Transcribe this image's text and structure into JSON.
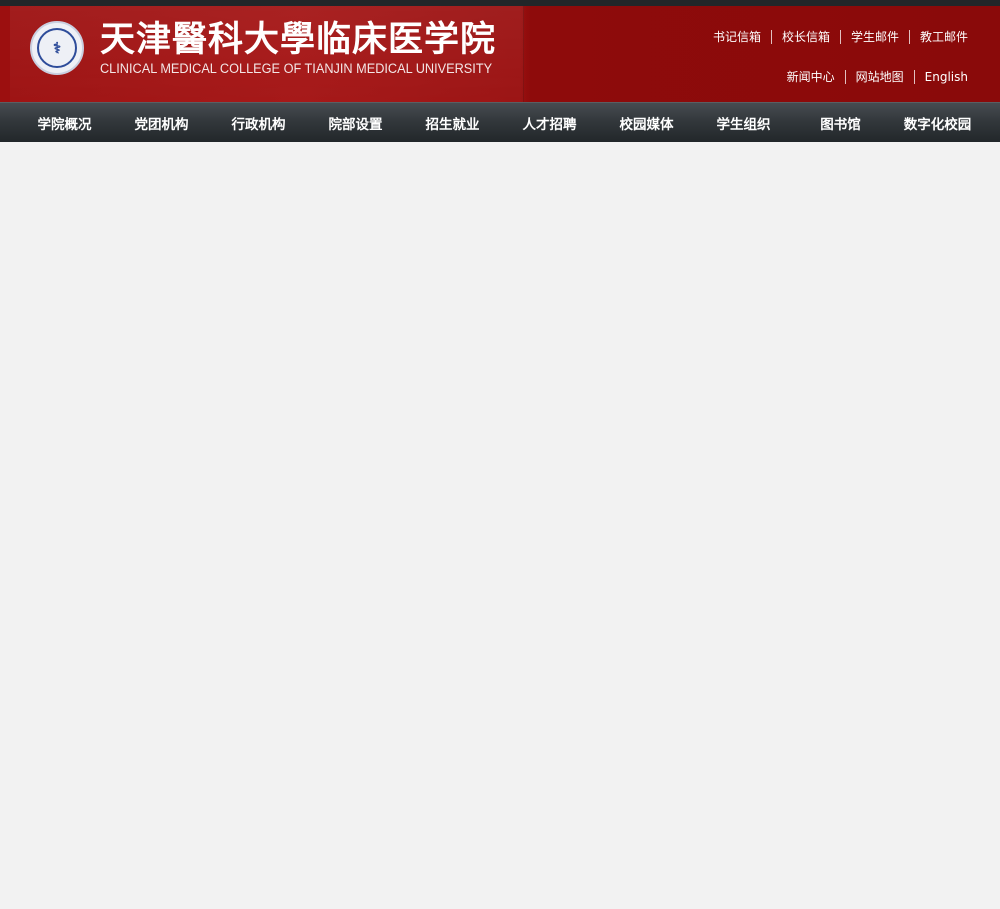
{
  "header": {
    "brand_cn": "天津醫科大學临床医学院",
    "brand_en": "CLINICAL MEDICAL COLLEGE OF TIANJIN MEDICAL UNIVERSITY",
    "seal_mark": "⚕"
  },
  "top_links_row1": [
    {
      "label": "书记信箱"
    },
    {
      "label": "校长信箱"
    },
    {
      "label": "学生邮件"
    },
    {
      "label": "教工邮件"
    }
  ],
  "top_links_row2": [
    {
      "label": "新闻中心"
    },
    {
      "label": "网站地图"
    },
    {
      "label": "English"
    }
  ],
  "nav": {
    "items": [
      {
        "label": "学院概况"
      },
      {
        "label": "党团机构"
      },
      {
        "label": "行政机构"
      },
      {
        "label": "院部设置"
      },
      {
        "label": "招生就业"
      },
      {
        "label": "人才招聘"
      },
      {
        "label": "校园媒体"
      },
      {
        "label": "学生组织"
      },
      {
        "label": "图书馆"
      },
      {
        "label": "数字化校园"
      }
    ]
  },
  "colors": {
    "header_red": "#9c0f0f",
    "nav_dark": "#33383c",
    "page_bg": "#f2f2f2"
  }
}
